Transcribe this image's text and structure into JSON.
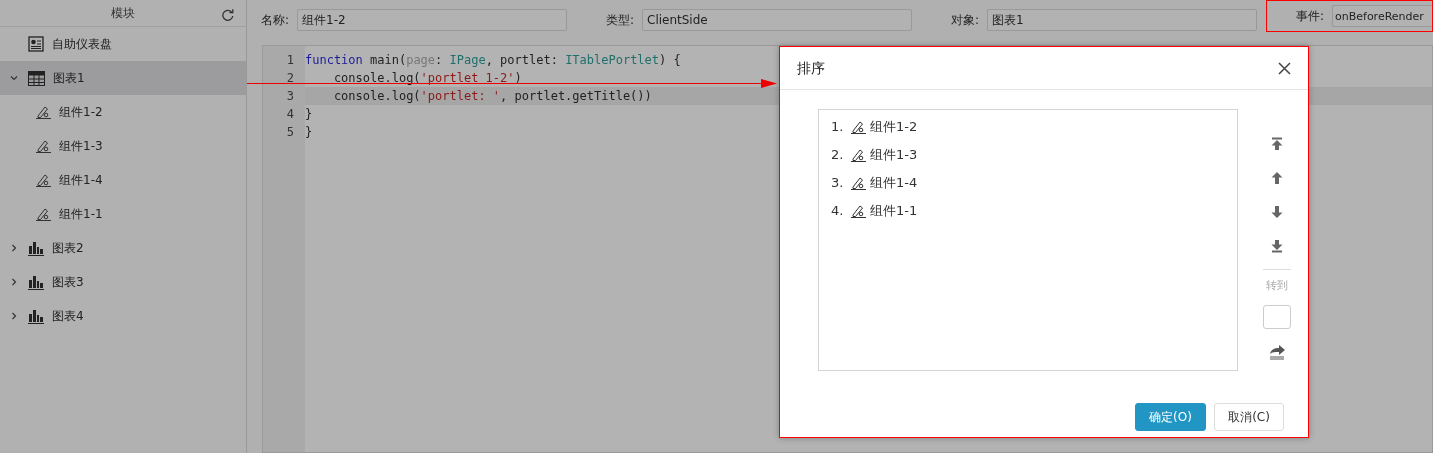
{
  "sidebar": {
    "title": "模块",
    "items": [
      {
        "label": "自助仪表盘",
        "kind": "dashboard",
        "selected": false
      },
      {
        "label": "图表1",
        "kind": "table",
        "selected": true,
        "expanded": true,
        "children": [
          {
            "label": "组件1-2",
            "kind": "component",
            "selected": false
          },
          {
            "label": "组件1-3",
            "kind": "component",
            "selected": false
          },
          {
            "label": "组件1-4",
            "kind": "component",
            "selected": false
          },
          {
            "label": "组件1-1",
            "kind": "component",
            "selected": false
          }
        ]
      },
      {
        "label": "图表2",
        "kind": "chart",
        "selected": false,
        "expanded": false
      },
      {
        "label": "图表3",
        "kind": "chart",
        "selected": false,
        "expanded": false
      },
      {
        "label": "图表4",
        "kind": "chart",
        "selected": false,
        "expanded": false
      }
    ]
  },
  "fields": [
    {
      "label": "名称:",
      "value": "组件1-2"
    },
    {
      "label": "类型:",
      "value": "ClientSide"
    },
    {
      "label": "对象:",
      "value": "图表1"
    },
    {
      "label": "事件:",
      "value": "onBeforeRender",
      "highlighted": true
    }
  ],
  "editor": {
    "lines": [
      {
        "number": "1",
        "active": false,
        "tokens": [
          {
            "text": "function",
            "kind": "keyword"
          },
          {
            "text": " main(",
            "kind": "plain"
          },
          {
            "text": "page",
            "kind": "param"
          },
          {
            "text": ": ",
            "kind": "plain"
          },
          {
            "text": "IPage",
            "kind": "type"
          },
          {
            "text": ", portlet: ",
            "kind": "plain"
          },
          {
            "text": "ITablePortlet",
            "kind": "type"
          },
          {
            "text": ") {",
            "kind": "plain"
          }
        ]
      },
      {
        "number": "2",
        "active": false,
        "tokens": [
          {
            "text": "    console.log(",
            "kind": "plain"
          },
          {
            "text": "'portlet 1-2'",
            "kind": "string"
          },
          {
            "text": ")",
            "kind": "plain"
          }
        ]
      },
      {
        "number": "3",
        "active": true,
        "tokens": [
          {
            "text": "    console.log(",
            "kind": "plain"
          },
          {
            "text": "'portlet: '",
            "kind": "string"
          },
          {
            "text": ", portlet.getTitle())",
            "kind": "plain"
          }
        ]
      },
      {
        "number": "4",
        "active": false,
        "tokens": [
          {
            "text": "}",
            "kind": "plain"
          }
        ]
      },
      {
        "number": "5",
        "active": false,
        "tokens": [
          {
            "text": "}",
            "kind": "plain"
          }
        ]
      }
    ]
  },
  "dialog": {
    "title": "排序",
    "items": [
      {
        "number": "1.",
        "label": "组件1-2"
      },
      {
        "number": "2.",
        "label": "组件1-3"
      },
      {
        "number": "3.",
        "label": "组件1-4"
      },
      {
        "number": "4.",
        "label": "组件1-1"
      }
    ],
    "tools": [
      {
        "kind": "top"
      },
      {
        "kind": "up"
      },
      {
        "kind": "down"
      },
      {
        "kind": "bottom"
      }
    ],
    "goto_label": "转到",
    "buttons": [
      {
        "label": "确定(O)",
        "kind": "primary"
      },
      {
        "label": "取消(C)",
        "kind": "secondary"
      }
    ]
  }
}
